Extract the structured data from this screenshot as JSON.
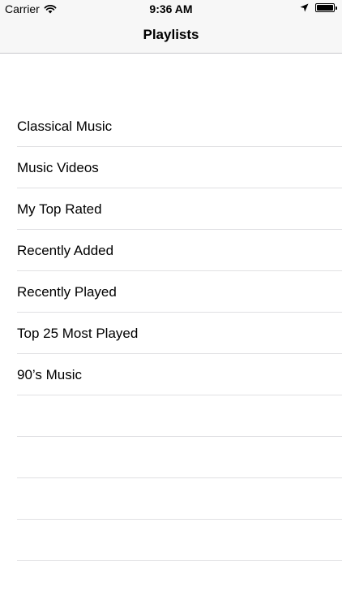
{
  "status_bar": {
    "carrier": "Carrier",
    "time": "9:36 AM",
    "wifi_icon": "wifi-icon",
    "location_icon": "location-arrow-icon",
    "battery_icon": "battery-icon",
    "battery_level": 1.0
  },
  "nav": {
    "title": "Playlists"
  },
  "playlists": [
    "Classical Music",
    "Music Videos",
    "My Top Rated",
    "Recently Added",
    "Recently Played",
    "Top 25 Most Played",
    "90’s Music"
  ],
  "empty_rows": 4,
  "colors": {
    "nav_background": "#f7f7f7",
    "separator": "#e0e0e3",
    "text": "#000000"
  }
}
